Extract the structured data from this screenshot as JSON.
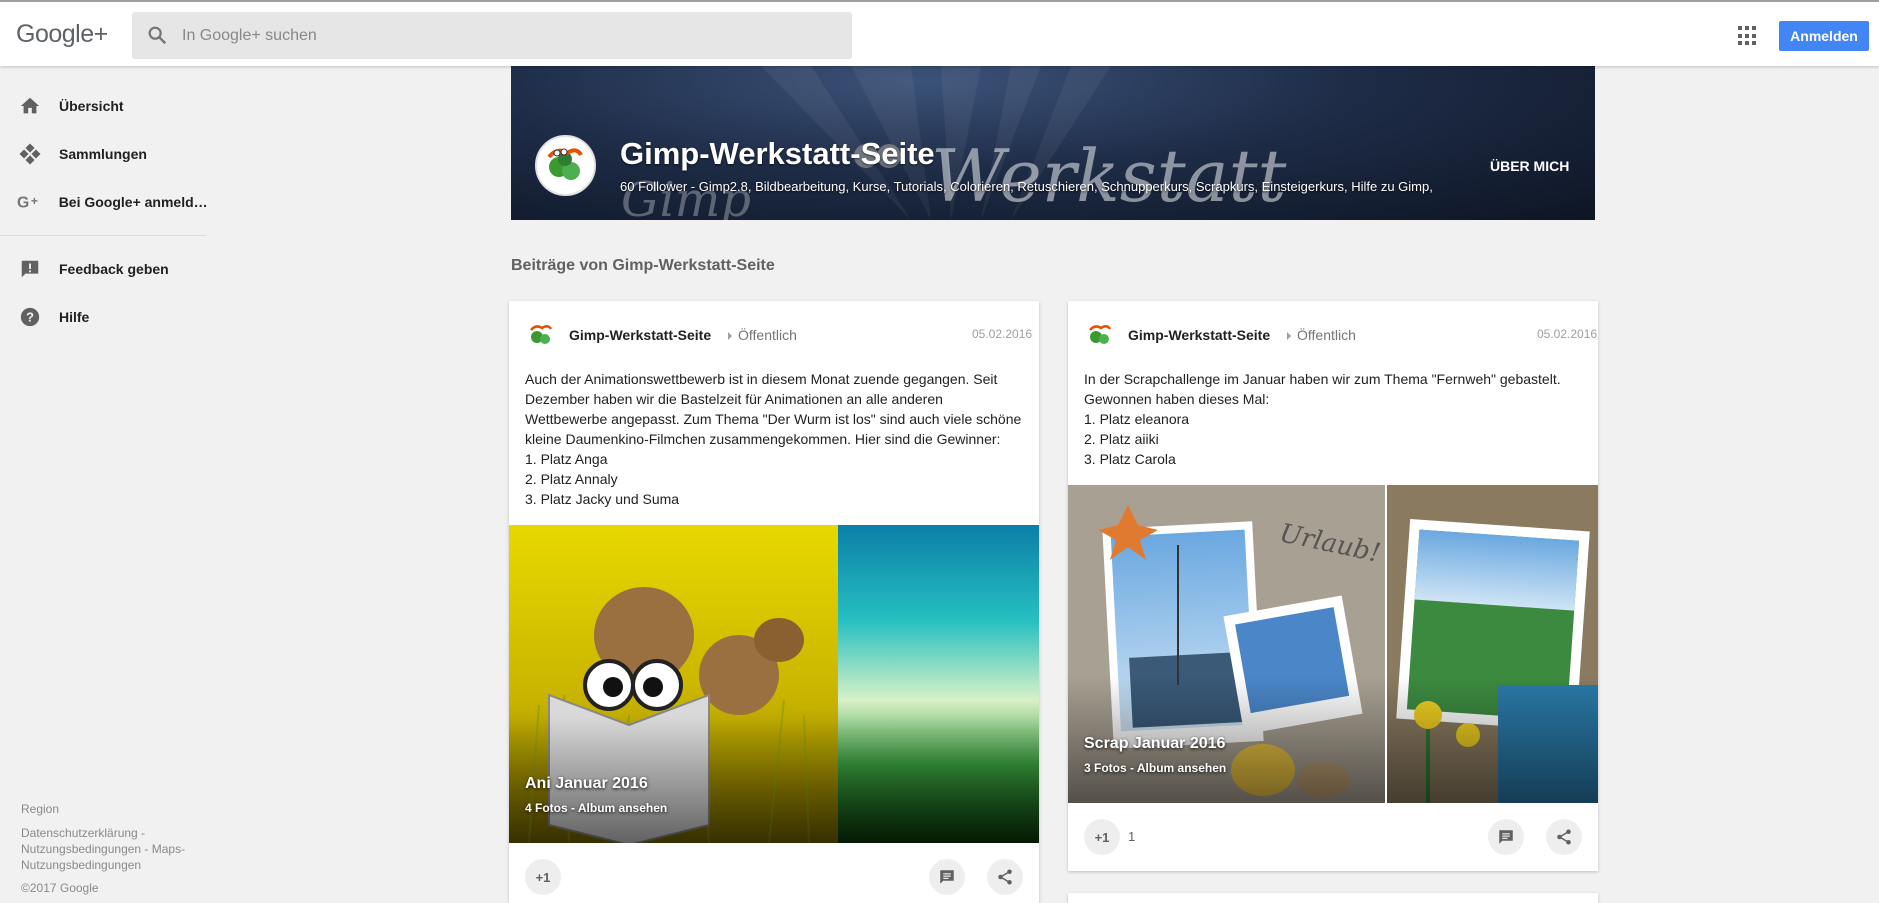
{
  "header": {
    "logo": "Google+",
    "search_placeholder": "In Google+ suchen",
    "signin_label": "Anmelden"
  },
  "sidebar": {
    "items": [
      {
        "label": "Übersicht",
        "icon": "home-icon"
      },
      {
        "label": "Sammlungen",
        "icon": "collections-icon"
      },
      {
        "label": "Bei Google+ anmeld…",
        "icon": "google-plus-icon"
      },
      {
        "label": "Feedback geben",
        "icon": "feedback-icon"
      },
      {
        "label": "Hilfe",
        "icon": "help-icon"
      }
    ],
    "footer": {
      "region": "Region",
      "privacy": "Datenschutzerklärung -",
      "terms": "Nutzungsbedingungen - Maps-",
      "maps_terms": "Nutzungsbedingungen",
      "copyright": "©2017 Google"
    }
  },
  "cover": {
    "title": "Gimp-Werkstatt-Seite",
    "description": "60 Follower - Gimp2.8, Bildbearbeitung, Kurse, Tutorials, Colorieren, Retuschieren, Schnupperkurs, Scrapkurs, Einsteigerkurs, Hilfe zu Gimp,",
    "about_label": "ÜBER MICH"
  },
  "posts_heading": "Beiträge von Gimp-Werkstatt-Seite",
  "posts": [
    {
      "author": "Gimp-Werkstatt-Seite",
      "visibility": "Öffentlich",
      "date": "05.02.2016",
      "text_lines": [
        "Auch der Animationswettbewerb ist in diesem Monat zuende gegangen. Seit",
        "Dezember haben wir die Bastelzeit für Animationen an alle anderen",
        "Wettbewerbe angepasst. Zum Thema \"Der Wurm ist los\" sind auch viele schöne",
        "kleine Daumenkino-Filmchen zusammengekommen. Hier sind die Gewinner:",
        "1. Platz Anga",
        "2. Platz Annaly",
        "3. Platz Jacky und Suma"
      ],
      "album_title": "Ani Januar 2016",
      "album_sub": "4 Fotos - Album ansehen",
      "plus_label": "+1",
      "plus_count": ""
    },
    {
      "author": "Gimp-Werkstatt-Seite",
      "visibility": "Öffentlich",
      "date": "05.02.2016",
      "text_lines": [
        "In der Scrapchallenge im Januar haben wir zum Thema \"Fernweh\" gebastelt.",
        "Gewonnen haben dieses Mal:",
        "1. Platz eleanora",
        "2. Platz aiiki",
        "3. Platz Carola"
      ],
      "album_title": "Scrap Januar 2016",
      "album_sub": "3 Fotos - Album ansehen",
      "plus_label": "+1",
      "plus_count": "1"
    }
  ],
  "colors": {
    "accent": "#4285f4",
    "background": "#f1f1f1"
  }
}
